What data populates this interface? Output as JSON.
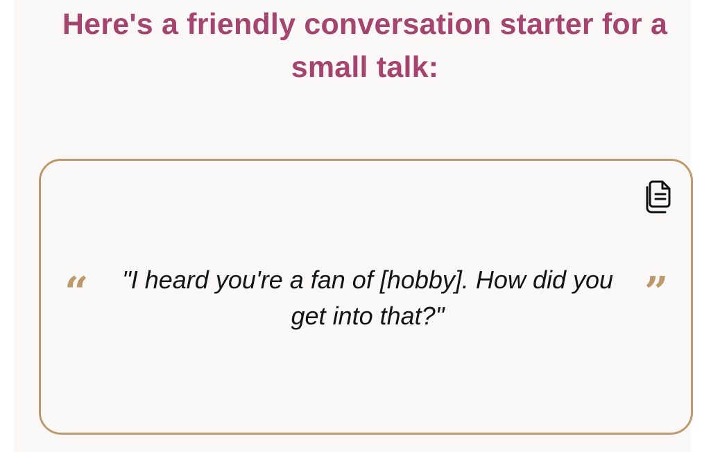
{
  "page": {
    "heading": "Here's a friendly conversation starter for a small talk:"
  },
  "quote": {
    "text": "\"I heard you're a fan of [hobby]. How did you get into that?\"",
    "open_mark": "“",
    "close_mark": "”"
  },
  "copy": {
    "icon": "copy-icon"
  },
  "colors": {
    "heading": "#a5456f",
    "accent": "#bd9a6e",
    "text": "#141414",
    "background": "#f9f8f6"
  }
}
